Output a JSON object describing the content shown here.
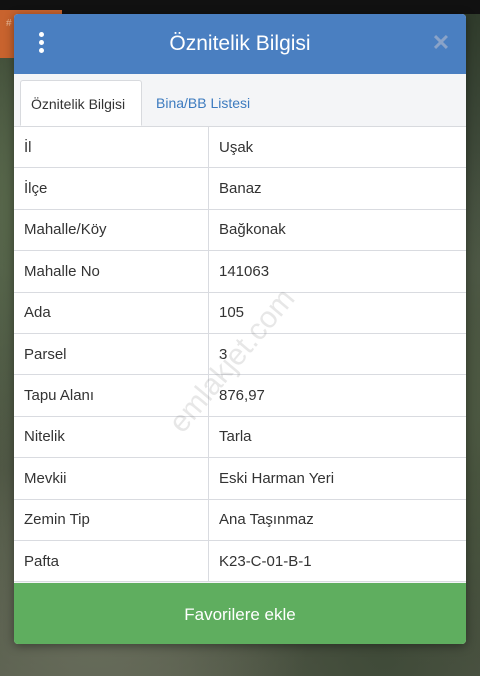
{
  "header": {
    "title": "Öznitelik Bilgisi",
    "menu_icon": "vertical-dots-icon",
    "close_icon": "close-icon"
  },
  "tabs": [
    {
      "label": "Öznitelik Bilgisi",
      "active": true
    },
    {
      "label": "Bina/BB Listesi",
      "active": false
    }
  ],
  "rows": [
    {
      "key": "İl",
      "value": "Uşak"
    },
    {
      "key": "İlçe",
      "value": "Banaz"
    },
    {
      "key": "Mahalle/Köy",
      "value": "Bağkonak"
    },
    {
      "key": "Mahalle No",
      "value": "141063"
    },
    {
      "key": "Ada",
      "value": "105"
    },
    {
      "key": "Parsel",
      "value": "3"
    },
    {
      "key": "Tapu Alanı",
      "value": "876,97"
    },
    {
      "key": "Nitelik",
      "value": "Tarla"
    },
    {
      "key": "Mevkii",
      "value": "Eski Harman Yeri"
    },
    {
      "key": "Zemin Tip",
      "value": "Ana Taşınmaz"
    },
    {
      "key": "Pafta",
      "value": "K23-C-01-B-1"
    }
  ],
  "watermark": "emlakjet.com",
  "footer": {
    "button_label": "Favorilere ekle"
  },
  "colors": {
    "header_bg": "#4a7fc1",
    "tab_link": "#3d7bbf",
    "button_bg": "#5fae5f"
  }
}
